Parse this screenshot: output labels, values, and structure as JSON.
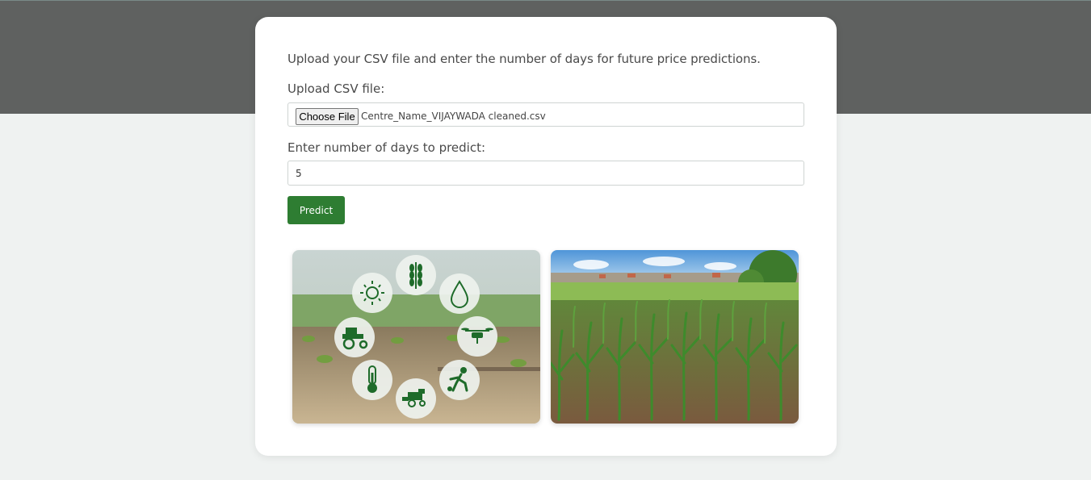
{
  "form": {
    "intro_text": "Upload your CSV file and enter the number of days for future price predictions.",
    "csv_label": "Upload CSV file:",
    "choose_file_label": "Choose File",
    "selected_file": "Centre_Name_VIJAYWADA cleaned.csv",
    "days_label": "Enter number of days to predict:",
    "days_value": "5",
    "predict_label": "Predict"
  },
  "images": [
    {
      "name": "smart-farming-icons-image",
      "icons": [
        "wheat-icon",
        "water-drop-icon",
        "drone-icon",
        "farmer-icon",
        "harvester-icon",
        "thermometer-icon",
        "tractor-icon",
        "sun-icon"
      ]
    },
    {
      "name": "corn-field-image"
    }
  ],
  "colors": {
    "header_band": "#5f6160",
    "page_background": "#eff2f1",
    "card": "#ffffff",
    "predict_button": "#2e7d32"
  }
}
